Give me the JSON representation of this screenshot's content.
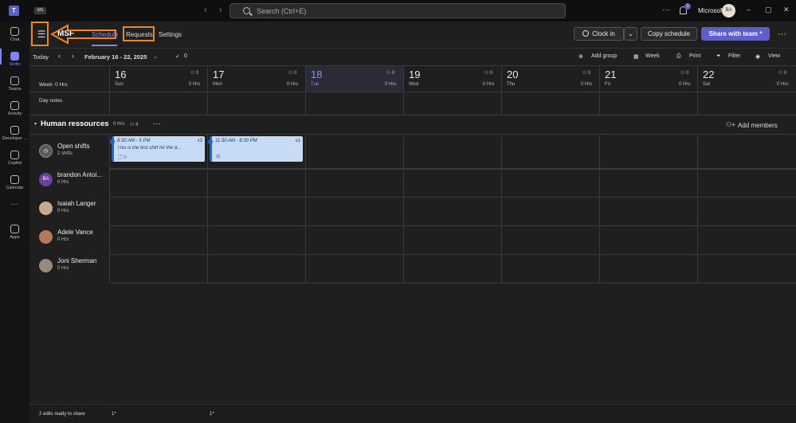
{
  "titlebar": {
    "app_logo": "T",
    "org_badge": "MS",
    "back_icon": "‹",
    "forward_icon": "›",
    "search_placeholder": "Search (Ctrl+E)",
    "more": "···",
    "notification_count": "1",
    "user_org": "Microsoft",
    "user_initials": "BA",
    "window_controls": [
      "–",
      "▢",
      "✕"
    ]
  },
  "rail": {
    "items": [
      {
        "label": "Chat",
        "icon": "chat-icon"
      },
      {
        "label": "Shifts",
        "icon": "shifts-icon",
        "active": true
      },
      {
        "label": "Teams",
        "icon": "teams-icon"
      },
      {
        "label": "Activity",
        "icon": "bell-icon"
      },
      {
        "label": "Developer ...",
        "icon": "developer-icon"
      },
      {
        "label": "Copilot",
        "icon": "copilot-icon"
      },
      {
        "label": "Calendar",
        "icon": "calendar-icon"
      },
      {
        "label": "···",
        "icon": "more-icon"
      },
      {
        "label": "Apps",
        "icon": "apps-icon"
      }
    ]
  },
  "header": {
    "team_name": "MSF",
    "tabs": [
      "Schedule",
      "Requests",
      "Settings"
    ],
    "clock_in": "Clock in",
    "copy_schedule": "Copy schedule",
    "share": "Share with team *"
  },
  "toolbar": {
    "today": "Today",
    "date_range": "February 16 - 22, 2025",
    "check_count": "0",
    "add_group": "Add group",
    "week": "Week",
    "print": "Print",
    "filter": "Filter",
    "view": "View"
  },
  "week_label": "Week: 0 Hrs",
  "day_notes": "Day notes",
  "days": [
    {
      "num": "16",
      "name": "Sun",
      "people": "0",
      "hrs": "0 Hrs"
    },
    {
      "num": "17",
      "name": "Mon",
      "people": "0",
      "hrs": "0 Hrs"
    },
    {
      "num": "18",
      "name": "Tue",
      "people": "0",
      "hrs": "0 Hrs",
      "today": true
    },
    {
      "num": "19",
      "name": "Wed",
      "people": "0",
      "hrs": "0 Hrs"
    },
    {
      "num": "20",
      "name": "Thu",
      "people": "0",
      "hrs": "0 Hrs"
    },
    {
      "num": "21",
      "name": "Fri",
      "people": "0",
      "hrs": "0 Hrs"
    },
    {
      "num": "22",
      "name": "Sat",
      "people": "0",
      "hrs": "0 Hrs"
    }
  ],
  "group": {
    "title": "Human ressources",
    "hrs": "0 Hrs",
    "members_count": "4",
    "more": "···",
    "add_members": "Add members"
  },
  "members": [
    {
      "name": "Open shifts",
      "hrs": "2 shifts",
      "initials": "",
      "color": "#5a5a5a"
    },
    {
      "name": "brandon Antoi...",
      "hrs": "0 Hrs",
      "initials": "BA",
      "color": "#6b3fa0"
    },
    {
      "name": "Isaiah Langer",
      "hrs": "0 Hrs",
      "initials": "",
      "color": "#c9a98a"
    },
    {
      "name": "Adele Vance",
      "hrs": "0 Hrs",
      "initials": "",
      "color": "#b5785a"
    },
    {
      "name": "Joni Sherman",
      "hrs": "0 Hrs",
      "initials": "",
      "color": "#9a8a7a"
    }
  ],
  "open_shifts": [
    {
      "time": "8:30 AM - 5 PM",
      "note": "This is the first shift for the d...",
      "count": "x3",
      "icons": "🗋 ◷"
    },
    {
      "time": "11:30 AM - 8:30 PM",
      "note": "",
      "count": "x1",
      "icons": "◷"
    }
  ],
  "footer": {
    "edits": "2 edits ready to share",
    "edit_marks": [
      "1*",
      "1*"
    ]
  },
  "colors": {
    "accent": "#7f85f5",
    "primary_button": "#5b5fc7",
    "annotation": "#f0862a",
    "shift_bg": "#c8dbf5"
  }
}
